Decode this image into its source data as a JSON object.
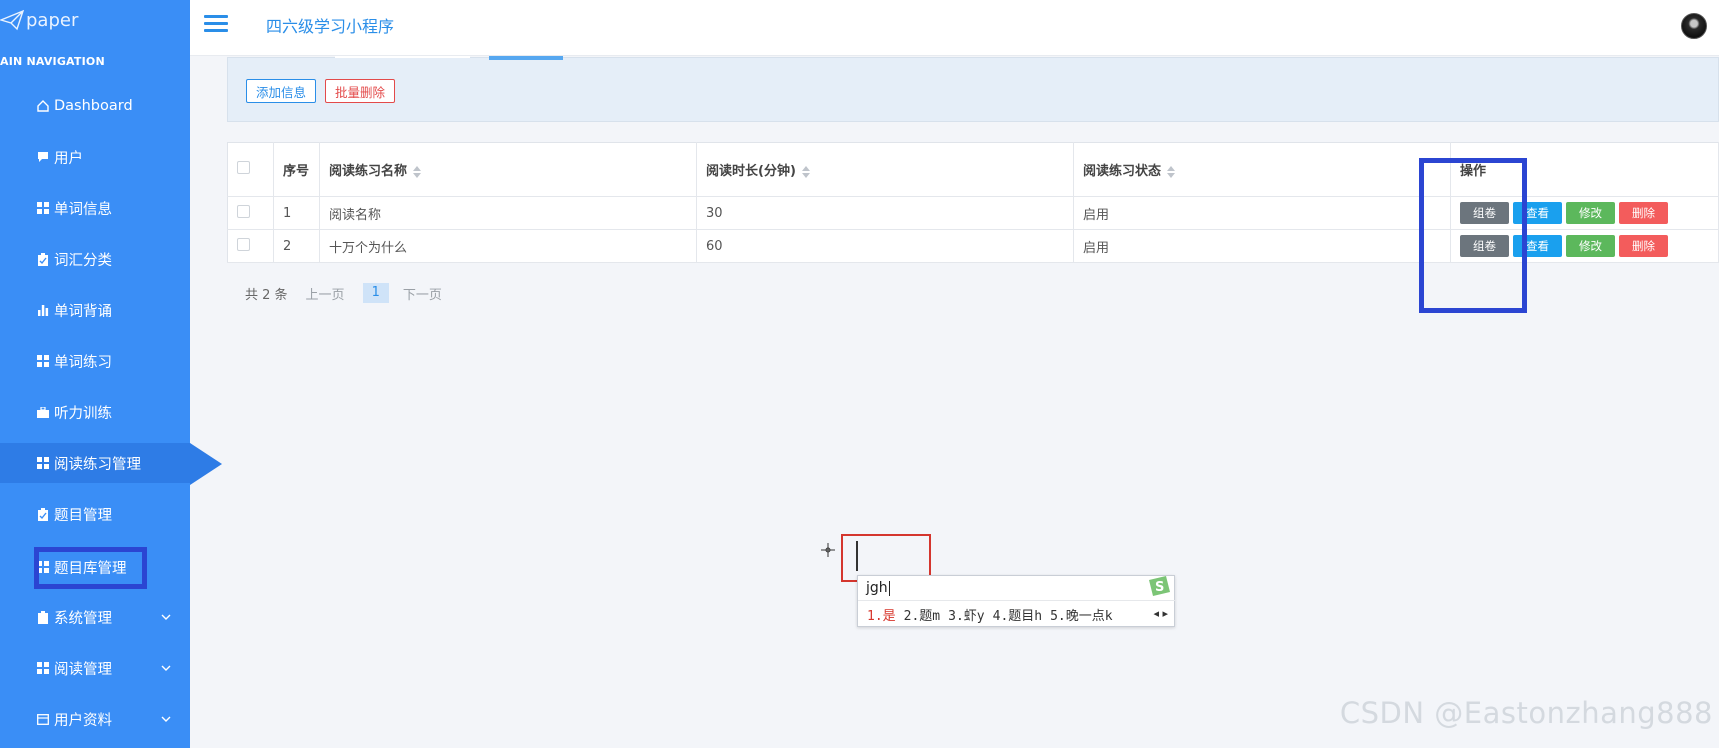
{
  "brand": {
    "name": "paper"
  },
  "sidebar": {
    "heading": "AIN NAVIGATION",
    "items": [
      {
        "label": "Dashboard",
        "icon": "home-icon"
      },
      {
        "label": "用户",
        "icon": "chat-icon"
      },
      {
        "label": "单词信息",
        "icon": "grid-icon"
      },
      {
        "label": "词汇分类",
        "icon": "clipboard-icon"
      },
      {
        "label": "单词背诵",
        "icon": "bar-chart-icon"
      },
      {
        "label": "单词练习",
        "icon": "grid-icon"
      },
      {
        "label": "听力训练",
        "icon": "briefcase-icon"
      },
      {
        "label": "阅读练习管理",
        "icon": "grid-icon",
        "active": true
      },
      {
        "label": "题目管理",
        "icon": "clipboard-icon"
      },
      {
        "label": "题目库管理",
        "icon": "grid-icon"
      },
      {
        "label": "系统管理",
        "icon": "clipboard-icon",
        "expandable": true
      },
      {
        "label": "阅读管理",
        "icon": "grid-icon",
        "expandable": true
      },
      {
        "label": "用户资料",
        "icon": "card-icon",
        "expandable": true
      }
    ]
  },
  "header": {
    "title": "四六级学习小程序"
  },
  "toolbar": {
    "add_label": "添加信息",
    "batch_delete_label": "批量删除"
  },
  "table": {
    "columns": [
      "序号",
      "阅读练习名称",
      "阅读时长(分钟)",
      "阅读练习状态",
      "操作"
    ],
    "rows": [
      {
        "index": "1",
        "name": "阅读名称",
        "duration": "30",
        "status": "启用"
      },
      {
        "index": "2",
        "name": "十万个为什么",
        "duration": "60",
        "status": "启用"
      }
    ],
    "actions": [
      "组卷",
      "查看",
      "修改",
      "删除"
    ]
  },
  "pagination": {
    "total": "共 2 条",
    "prev": "上一页",
    "current": "1",
    "next": "下一页"
  },
  "ime": {
    "input": "jgh",
    "candidates": [
      "1.是",
      "2.题m",
      "3.虾y",
      "4.题目h",
      "5.晚一点k"
    ]
  },
  "watermark": "CSDN @Eastonzhang888",
  "colors": {
    "sidebar": "#3a8ef6",
    "accent": "#2a8ee8",
    "highlight_box": "#2b45d2",
    "ime_box": "#d4362e"
  }
}
